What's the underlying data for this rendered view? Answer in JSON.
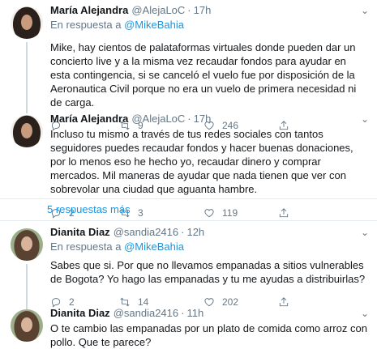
{
  "tweets": [
    {
      "name": "María Alejandra",
      "handle": "@AlejaLoC",
      "time": "17h",
      "reply_prefix": "En respuesta a",
      "reply_to": "@MikeBahia",
      "text": "Mike, hay cientos de palataformas virtuales donde pueden dar un concierto live y a la misma vez recaudar fondos para ayudar en esta contingencia, si se canceló el vuelo fue por disposición de la Aeronautica Civil porque no era un vuelo de primera necesidad ni de carga.",
      "replies": "",
      "retweets": "9",
      "likes": "246"
    },
    {
      "name": "María Alejandra",
      "handle": "@AlejaLoC",
      "time": "17h",
      "text": "Incluso tu mismo a través de tus redes sociales con tantos seguidores puedes recaudar fondos y hacer buenas donaciones, por lo menos eso he hecho yo, recaudar dinero y comprar mercados. Mil maneras de ayudar que nada tienen que ver con sobrevolar una ciudad que aguanta hambre.",
      "replies": "2",
      "retweets": "3",
      "likes": "119"
    },
    {
      "name": "Dianita Diaz",
      "handle": "@sandia2416",
      "time": "12h",
      "reply_prefix": "En respuesta a",
      "reply_to": "@MikeBahia",
      "text": "Sabes que si. Por que no llevamos empanadas a sitios vulnerables de Bogota? Yo hago las empanadas y tu me ayudas a distribuirlas?",
      "replies": "2",
      "retweets": "14",
      "likes": "202"
    },
    {
      "name": "Dianita Diaz",
      "handle": "@sandia2416",
      "time": "11h",
      "text": "O te cambio las empanadas por un plato de comida como arroz con pollo. Que te parece?"
    }
  ],
  "more_replies": "5 respuestas más",
  "icons": {
    "reply": "reply-icon",
    "retweet": "retweet-icon",
    "like": "heart-icon",
    "share": "share-icon",
    "caret": "chevron-down-icon"
  },
  "colors": {
    "link": "#1b95e0",
    "secondary_text": "#657786",
    "primary_text": "#14171a",
    "divider": "#e6ecf0"
  }
}
